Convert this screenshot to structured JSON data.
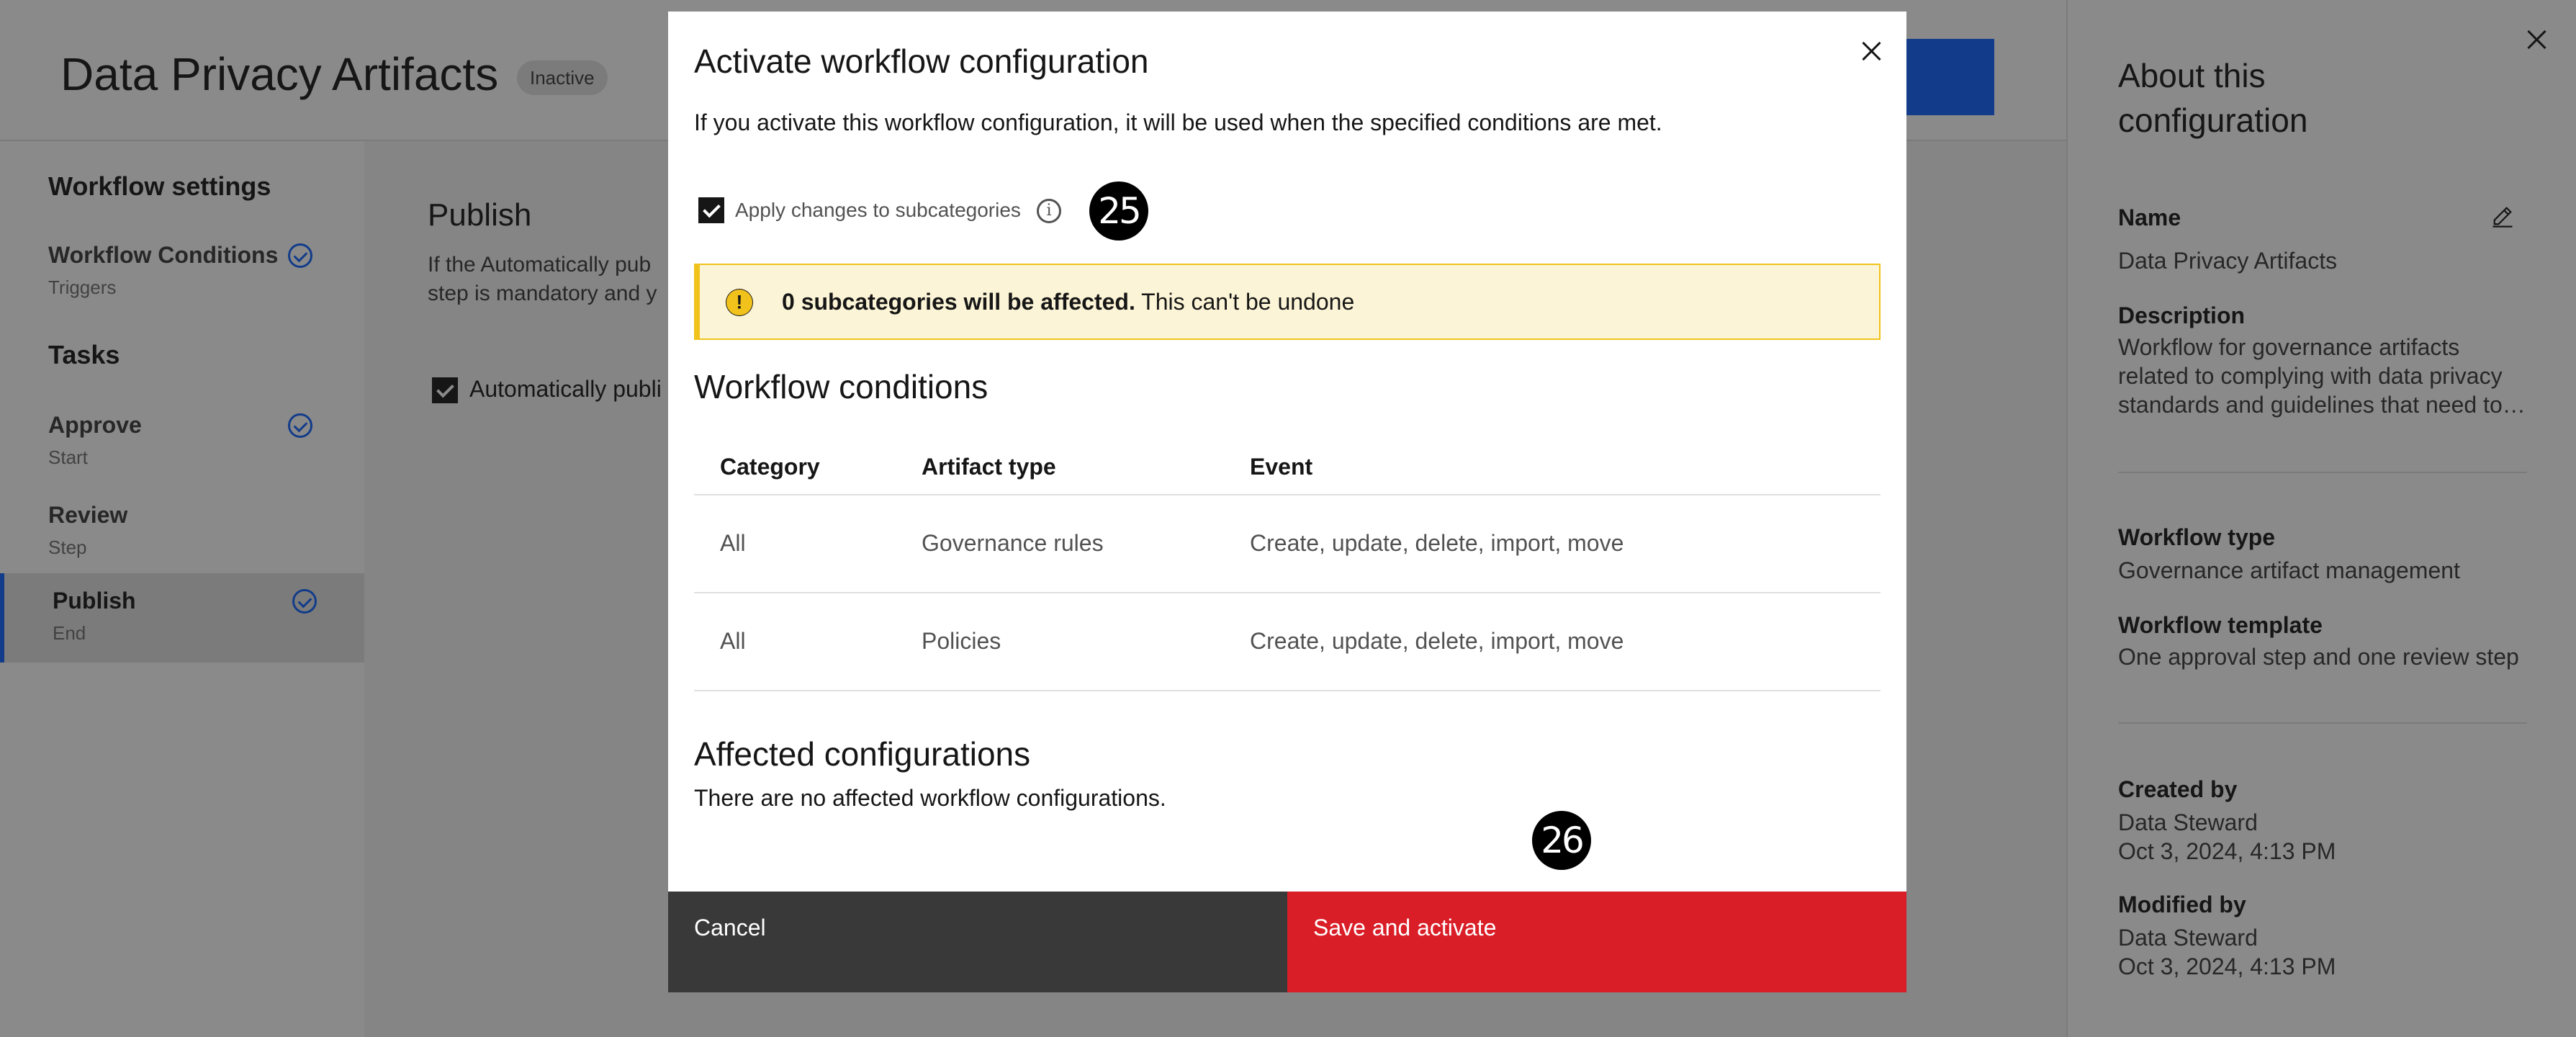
{
  "page": {
    "title": "Data Privacy Artifacts",
    "status": "Inactive"
  },
  "nav": {
    "settings_title": "Workflow settings",
    "tasks_title": "Tasks",
    "items": [
      {
        "label": "Workflow Conditions",
        "sub": "Triggers"
      },
      {
        "label": "Approve",
        "sub": "Start"
      },
      {
        "label": "Review",
        "sub": "Step"
      },
      {
        "label": "Publish",
        "sub": "End"
      }
    ]
  },
  "main": {
    "title": "Publish",
    "desc_line1": "If the Automatically pub",
    "desc_line2": "step is mandatory and y",
    "checkbox_label": "Automatically publi"
  },
  "right_panel": {
    "title": "About this configuration",
    "name_label": "Name",
    "name_value": "Data Privacy Artifacts",
    "description_label": "Description",
    "description_value": "Workflow for governance artifacts related to complying with data privacy standards and guidelines that need to…",
    "workflow_type_label": "Workflow type",
    "workflow_type_value": "Governance artifact management",
    "workflow_template_label": "Workflow template",
    "workflow_template_value": "One approval step and one review step",
    "created_by_label": "Created by",
    "created_by_user": "Data Steward",
    "created_by_date": "Oct 3, 2024, 4:13 PM",
    "modified_by_label": "Modified by",
    "modified_by_user": "Data Steward",
    "modified_by_date": "Oct 3, 2024, 4:13 PM"
  },
  "modal": {
    "title": "Activate workflow configuration",
    "description": "If you activate this workflow configuration, it will be used when the specified conditions are met.",
    "checkbox_label": "Apply changes to subcategories",
    "warning_bold": "0 subcategories will be affected.",
    "warning_text": " This can't be undone",
    "conditions_title": "Workflow conditions",
    "table": {
      "headers": [
        "Category",
        "Artifact type",
        "Event"
      ],
      "rows": [
        [
          "All",
          "Governance rules",
          "Create, update, delete, import, move"
        ],
        [
          "All",
          "Policies",
          "Create, update, delete, import, move"
        ]
      ]
    },
    "affected_title": "Affected configurations",
    "affected_text": "There are no affected workflow configurations.",
    "cancel_label": "Cancel",
    "save_label": "Save and activate"
  },
  "badges": {
    "b1": "25",
    "b2": "26"
  },
  "colors": {
    "primary": "#0f62fe",
    "danger": "#da1e28",
    "warning_bg": "#fcf4d6",
    "warning_border": "#f1c21b"
  }
}
